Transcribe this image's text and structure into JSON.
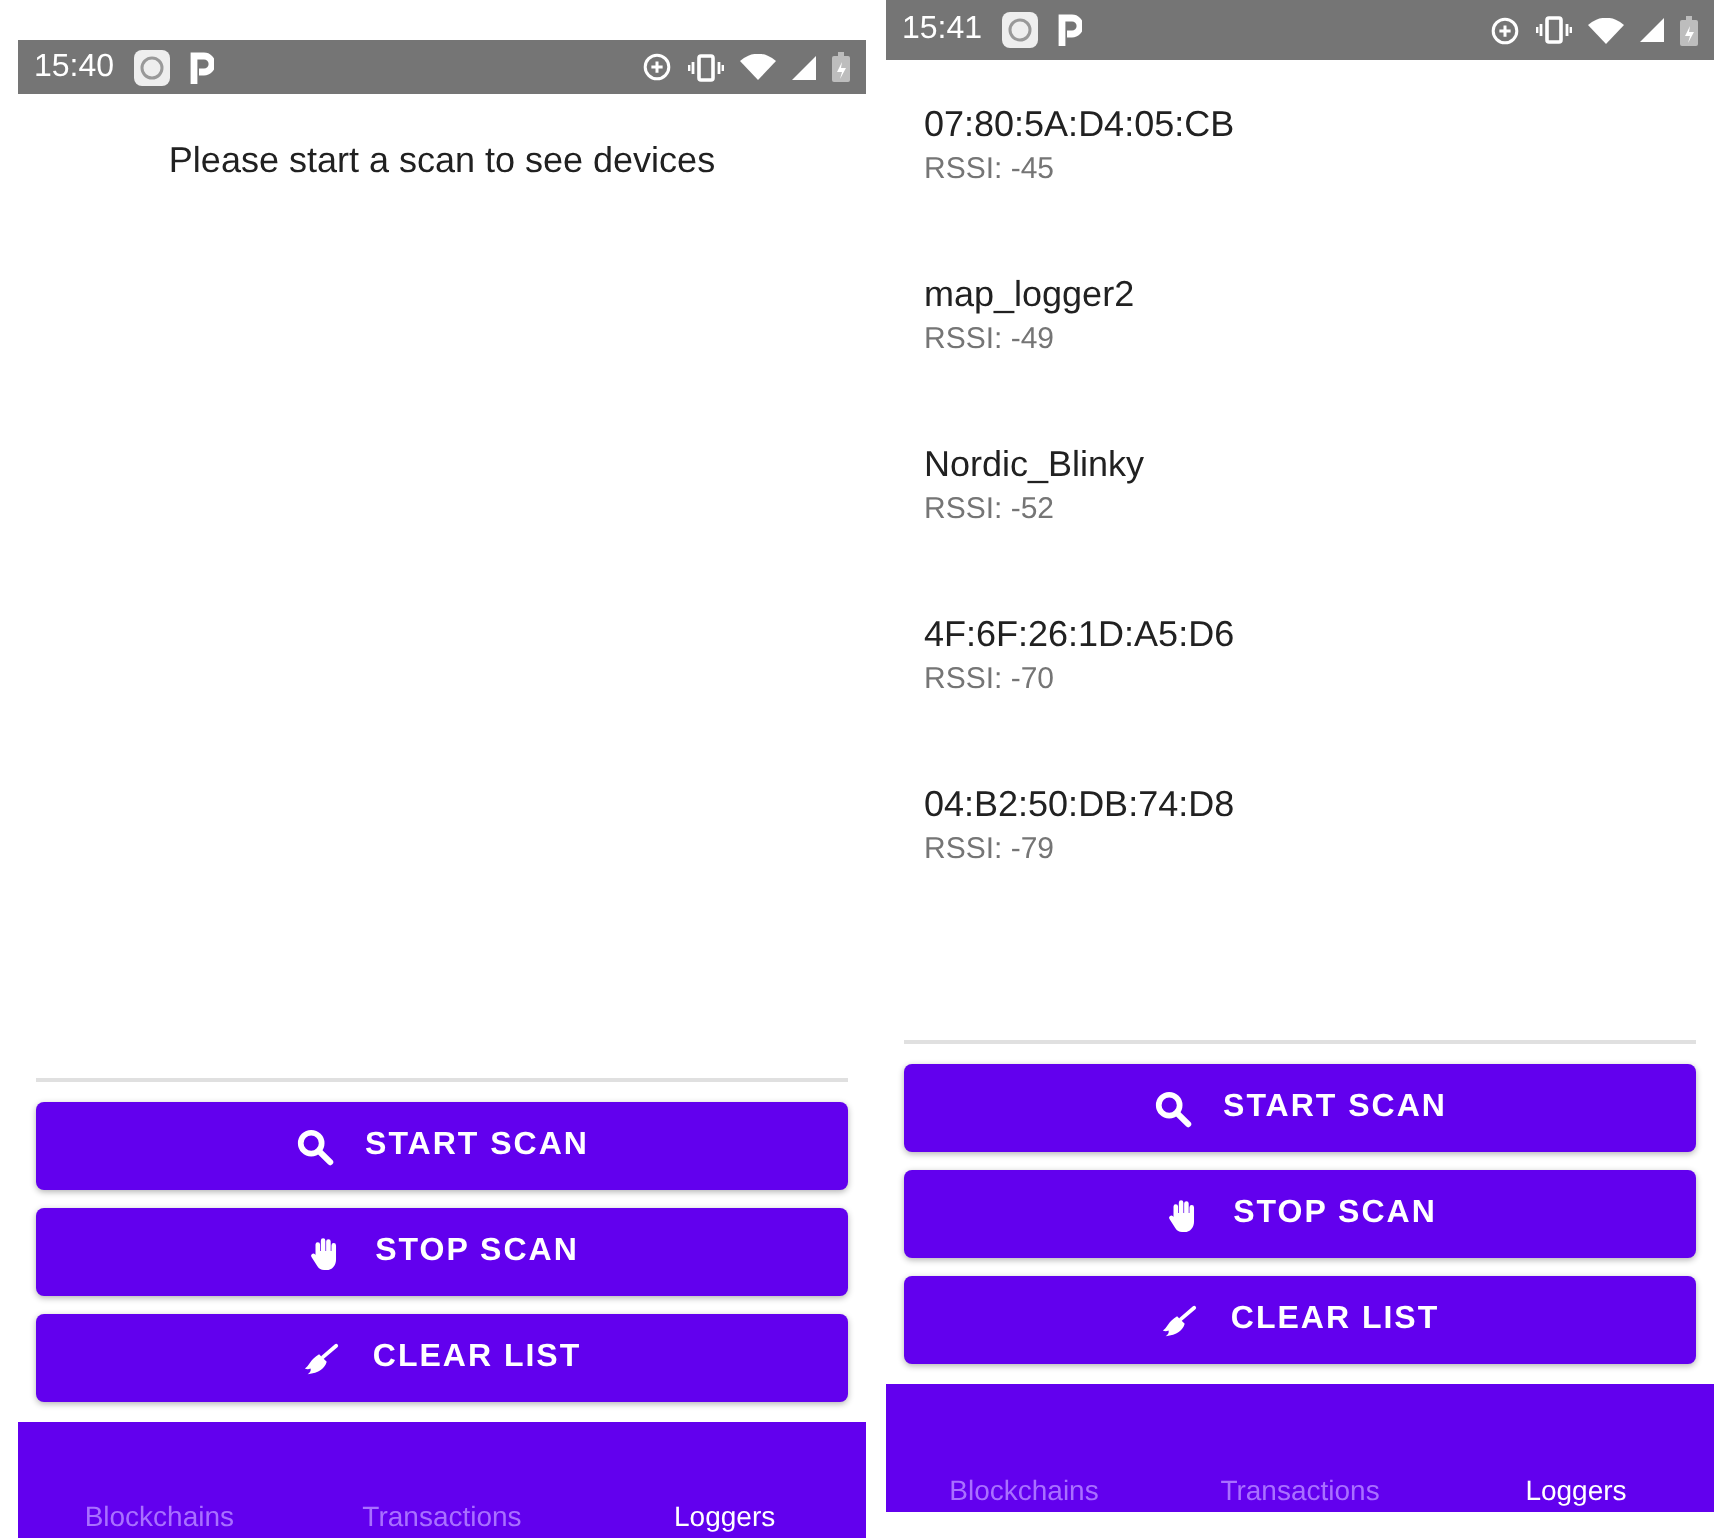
{
  "screens": [
    {
      "status_bar": {
        "time": "15:40"
      },
      "message": "Please start a scan to see devices",
      "buttons": [
        {
          "kind": "search",
          "label": "START SCAN"
        },
        {
          "kind": "stop",
          "label": "STOP SCAN"
        },
        {
          "kind": "clear",
          "label": "CLEAR LIST"
        }
      ],
      "tabs": [
        {
          "label": "Blockchains",
          "selected": false
        },
        {
          "label": "Transactions",
          "selected": false
        },
        {
          "label": "Loggers",
          "selected": true
        }
      ]
    },
    {
      "status_bar": {
        "time": "15:41"
      },
      "devices": [
        {
          "name": "07:80:5A:D4:05:CB",
          "rssi": "RSSI: -45"
        },
        {
          "name": "map_logger2",
          "rssi": "RSSI: -49"
        },
        {
          "name": "Nordic_Blinky",
          "rssi": "RSSI: -52"
        },
        {
          "name": "4F:6F:26:1D:A5:D6",
          "rssi": "RSSI: -70"
        },
        {
          "name": "04:B2:50:DB:74:D8",
          "rssi": "RSSI: -79"
        }
      ],
      "buttons": [
        {
          "kind": "search",
          "label": "START SCAN"
        },
        {
          "kind": "stop",
          "label": "STOP SCAN"
        },
        {
          "kind": "clear",
          "label": "CLEAR LIST"
        }
      ],
      "tabs": [
        {
          "label": "Blockchains",
          "selected": false
        },
        {
          "label": "Transactions",
          "selected": false
        },
        {
          "label": "Loggers",
          "selected": true
        }
      ]
    }
  ]
}
